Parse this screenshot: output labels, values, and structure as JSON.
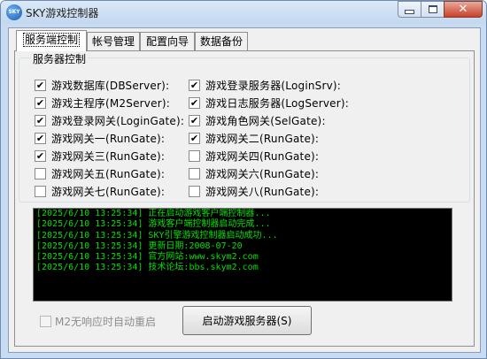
{
  "window": {
    "title": "SKY游戏控制器",
    "icon": "sky-logo-icon",
    "icon_text": "SKY"
  },
  "tabs": [
    {
      "label": "服务端控制",
      "active": true
    },
    {
      "label": "帐号管理",
      "active": false
    },
    {
      "label": "配置向导",
      "active": false
    },
    {
      "label": "数据备份",
      "active": false
    }
  ],
  "server_group": {
    "title": "服务器控制",
    "left": [
      {
        "label": "游戏数据库(DBServer):",
        "checked": true
      },
      {
        "label": "游戏主程序(M2Server):",
        "checked": true
      },
      {
        "label": "游戏登录网关(LoginGate):",
        "checked": true
      },
      {
        "label": "游戏网关一(RunGate):",
        "checked": true
      },
      {
        "label": "游戏网关三(RunGate):",
        "checked": true
      },
      {
        "label": "游戏网关五(RunGate):",
        "checked": false
      },
      {
        "label": "游戏网关七(RunGate):",
        "checked": false
      }
    ],
    "right": [
      {
        "label": "游戏登录服务器(LoginSrv):",
        "checked": true
      },
      {
        "label": "游戏日志服务器(LogServer):",
        "checked": true
      },
      {
        "label": "游戏角色网关(SelGate):",
        "checked": true
      },
      {
        "label": "游戏网关二(RunGate):",
        "checked": true
      },
      {
        "label": "游戏网关四(RunGate):",
        "checked": false
      },
      {
        "label": "游戏网关六(RunGate):",
        "checked": false
      },
      {
        "label": "游戏网关八(RunGate):",
        "checked": false
      }
    ]
  },
  "log": [
    "[2025/6/10 13:25:34] 正在启动游戏客户端控制器...",
    "[2025/6/10 13:25:34] 游戏客户端控制器启动完成...",
    "[2025/6/10 13:25:34] SKY引擎游戏控制器启动成功...",
    "[2025/6/10 13:25:34] 更新日期:2008-07-20",
    "[2025/6/10 13:25:34] 官方网站:www.skym2.com",
    "[2025/6/10 13:25:34] 技术论坛:bbs.skym2.com"
  ],
  "auto_restart_label": "M2无响应时自动重启",
  "start_button_label": "启动游戏服务器(S)",
  "colors": {
    "log_text": "#00e000",
    "log_bg": "#000000",
    "title_bar": "#c7dcf2",
    "close_button": "#c7412b"
  }
}
